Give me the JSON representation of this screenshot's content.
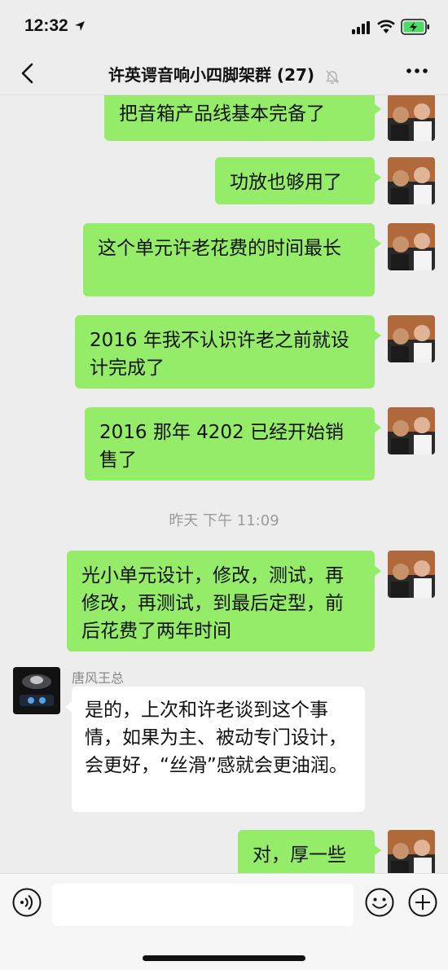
{
  "status_bar": {
    "time": "12:32"
  },
  "header": {
    "title": "许英谔音响小四脚架群 (27)"
  },
  "messages": [
    {
      "text": "把音箱产品线基本完备了"
    },
    {
      "text": "功放也够用了"
    },
    {
      "text": "这个单元许老花费的时间最长"
    },
    {
      "text": "2016 年我不认识许老之前就设计完成了"
    },
    {
      "text": "2016 那年 4202 已经开始销售了"
    },
    {
      "timestamp": "昨天 下午 11:09"
    },
    {
      "text": "光小单元设计，修改，测试，再修改，再测试，到最后定型，前后花费了两年时间"
    },
    {
      "sender": "唐风王总",
      "text": "是的，上次和许老谈到这个事情，如果为主、被动专门设计，会更好，“丝滑”感就会更油润。"
    },
    {
      "text": "对，厚一些"
    }
  ],
  "input": {
    "placeholder": ""
  },
  "colors": {
    "outgoing_bubble": "#95ec69",
    "incoming_bubble": "#ffffff",
    "background": "#ededed"
  }
}
